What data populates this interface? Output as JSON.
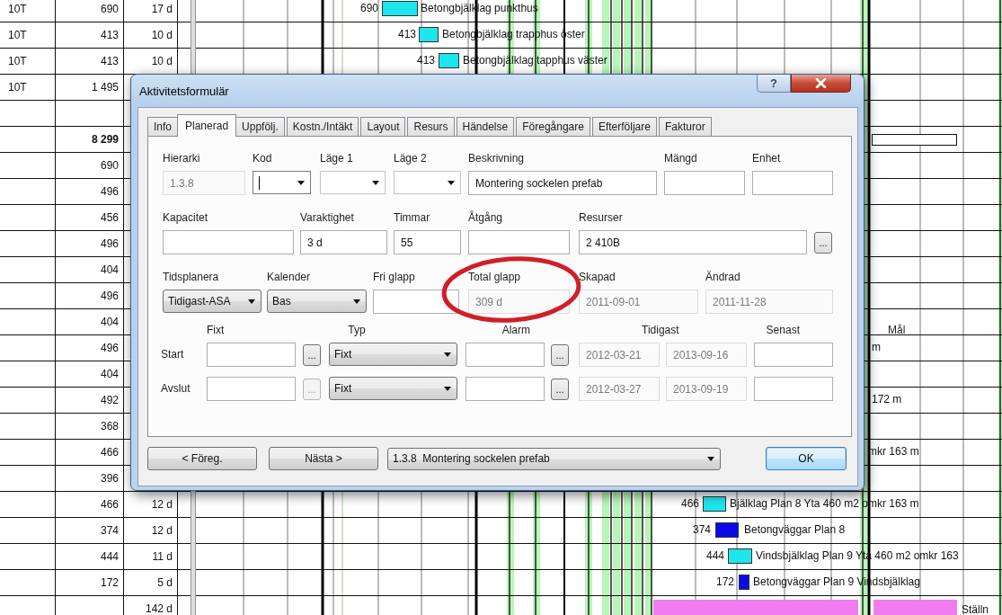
{
  "sheet": {
    "rows": [
      {
        "kind": "task",
        "code": "10T",
        "amount": "690",
        "duration": "17 d",
        "bar": {
          "kind": "task",
          "value": "690",
          "color": "#1ee6ee",
          "label": "Betongbjälklag punkthus"
        }
      },
      {
        "kind": "task",
        "code": "10T",
        "amount": "413",
        "duration": "10 d",
        "bar": {
          "kind": "task",
          "value": "413",
          "color": "#1ee6ee",
          "label": "Betongbjälklag trapphus öster"
        }
      },
      {
        "kind": "task",
        "code": "10T",
        "amount": "413",
        "duration": "10 d",
        "bar": {
          "kind": "task",
          "value": "413",
          "color": "#1ee6ee",
          "label": "Betongbjälklag tapphus väster"
        }
      },
      {
        "kind": "task",
        "code": "10T",
        "amount": "1 495"
      },
      {},
      {
        "kind": "total",
        "amount": "8 299",
        "bar": {
          "kind": "summary"
        }
      },
      {
        "kind": "task",
        "amount": "690"
      },
      {
        "kind": "task",
        "amount": "496"
      },
      {
        "kind": "task",
        "amount": "456"
      },
      {
        "kind": "task",
        "amount": "496"
      },
      {
        "kind": "task",
        "amount": "404"
      },
      {
        "kind": "task",
        "amount": "496"
      },
      {
        "kind": "task",
        "amount": "404"
      },
      {
        "kind": "task",
        "amount": "496",
        "bar": {
          "kind": "label",
          "label": "m"
        }
      },
      {
        "kind": "task",
        "amount": "404"
      },
      {
        "kind": "task",
        "amount": "492",
        "bar": {
          "kind": "label",
          "label": "172 m"
        }
      },
      {
        "kind": "task",
        "amount": "368"
      },
      {
        "kind": "task",
        "amount": "466",
        "bar": {
          "kind": "label",
          "label": "mkr 163 m"
        }
      },
      {
        "kind": "task",
        "amount": "396"
      },
      {
        "kind": "task",
        "amount": "466",
        "duration": "12 d",
        "bar": {
          "kind": "task",
          "value": "466",
          "color": "#1ee6ee",
          "label": "Bjälklag Plan 8 Yta 460 m2 omkr 163 m"
        }
      },
      {
        "kind": "task",
        "amount": "374",
        "duration": "12 d",
        "bar": {
          "kind": "task",
          "value": "374",
          "color": "#0a0ae6",
          "label": "Betongväggar Plan 8"
        }
      },
      {
        "kind": "task",
        "amount": "444",
        "duration": "11 d",
        "bar": {
          "kind": "task",
          "value": "444",
          "color": "#1ee6ee",
          "label": "Vindsbjälklag Plan 9 Yta 460 m2 omkr 163"
        }
      },
      {
        "kind": "task",
        "amount": "172",
        "duration": "5 d",
        "bar": {
          "kind": "task",
          "value": "172",
          "color": "#0a0ae6",
          "label": "Betongväggar Plan 9 Vindsbjälklag"
        }
      },
      {
        "duration": "142 d",
        "bar": {
          "kind": "phase",
          "color": "#f07cf0",
          "label": "Ställn"
        }
      }
    ]
  },
  "dialog": {
    "title": "Aktivitetsformulär",
    "help": "?",
    "tabs": [
      {
        "label": "Info",
        "selected": false
      },
      {
        "label": "Planerad",
        "selected": true
      },
      {
        "label": "Uppfölj.",
        "selected": false
      },
      {
        "label": "Kostn./Intäkt",
        "selected": false
      },
      {
        "label": "Layout",
        "selected": false
      },
      {
        "label": "Resurs",
        "selected": false
      },
      {
        "label": "Händelse",
        "selected": false
      },
      {
        "label": "Föregångare",
        "selected": false
      },
      {
        "label": "Efterföljare",
        "selected": false
      },
      {
        "label": "Fakturor",
        "selected": false
      }
    ],
    "form": {
      "rows": [
        {
          "fields": [
            {
              "label": "Hierarki",
              "kind": "text",
              "value": "1.3.8",
              "disabled": true,
              "focused": false
            },
            {
              "label": "Kod",
              "kind": "combo",
              "disabled": false,
              "focused": true
            },
            {
              "label": "Läge 1",
              "kind": "combo",
              "disabled": false,
              "focused": false
            },
            {
              "label": "Läge 2",
              "kind": "combo",
              "disabled": false,
              "focused": false
            },
            {
              "label": "Beskrivning",
              "kind": "text",
              "value": "Montering sockelen prefab",
              "disabled": false,
              "focused": false
            },
            {
              "label": "Mängd",
              "kind": "text",
              "disabled": false,
              "focused": false
            },
            {
              "label": "Enhet",
              "kind": "text",
              "disabled": false,
              "focused": false
            }
          ]
        },
        {
          "fields": [
            {
              "label": "Kapacitet",
              "kind": "text",
              "disabled": false,
              "focused": false
            },
            {
              "label": "Varaktighet",
              "kind": "text",
              "value": "3 d",
              "disabled": false,
              "focused": false
            },
            {
              "label": "Timmar",
              "kind": "text",
              "value": "55",
              "disabled": false,
              "focused": false
            },
            {
              "label": "Åtgång",
              "kind": "text",
              "disabled": false,
              "focused": false
            },
            {
              "label": "Resurser",
              "kind": "text",
              "value": "2 410B",
              "disabled": false,
              "focused": false
            },
            {
              "kind": "button",
              "value": "...",
              "disabled": false,
              "focused": false
            }
          ]
        },
        {
          "fields": [
            {
              "label": "Tidsplanera",
              "kind": "dropdown",
              "value": "Tidigast-ASA",
              "disabled": false,
              "focused": false
            },
            {
              "label": "Kalender",
              "kind": "dropdown",
              "value": "Bas",
              "disabled": false,
              "focused": false
            },
            {
              "label": "Fri glapp",
              "kind": "text",
              "disabled": false,
              "focused": false
            },
            {
              "label": "Total glapp",
              "kind": "text",
              "value": "309 d",
              "disabled": true,
              "focused": false
            },
            {
              "label": "Skapad",
              "kind": "text",
              "value": "2011-09-01",
              "disabled": true,
              "focused": false
            },
            {
              "label": "Ändrad",
              "kind": "text",
              "value": "2011-11-28",
              "disabled": true,
              "focused": false
            }
          ]
        }
      ]
    },
    "schedule": {
      "headers": [
        "Fixt",
        "Typ",
        "Alarm",
        "Tidigast",
        "Senast",
        "Mål"
      ],
      "rows": [
        {
          "label": "Start",
          "fields": [
            {
              "kind": "text",
              "disabled": false
            },
            {
              "kind": "button",
              "value": "...",
              "disabled": false
            },
            {
              "kind": "dropdown",
              "value": "Fixt",
              "disabled": false
            },
            {
              "kind": "text",
              "disabled": false
            },
            {
              "kind": "button",
              "value": "...",
              "disabled": false
            },
            {
              "kind": "text",
              "value": "2012-03-21",
              "disabled": true
            },
            {
              "kind": "text",
              "value": "2013-09-16",
              "disabled": true
            },
            {
              "kind": "text",
              "disabled": false
            }
          ]
        },
        {
          "label": "Avslut",
          "fields": [
            {
              "kind": "text",
              "disabled": false
            },
            {
              "kind": "button",
              "value": "...",
              "disabled": true
            },
            {
              "kind": "dropdown",
              "value": "Fixt",
              "disabled": false
            },
            {
              "kind": "text",
              "disabled": false
            },
            {
              "kind": "button",
              "value": "...",
              "disabled": false
            },
            {
              "kind": "text",
              "value": "2012-03-27",
              "disabled": true
            },
            {
              "kind": "text",
              "value": "2013-09-19",
              "disabled": true
            },
            {
              "kind": "text",
              "disabled": false
            }
          ]
        }
      ]
    },
    "footer": {
      "previous": "< Föreg.",
      "next": "Nästa >",
      "activity": "1.3.8  Montering sockelen prefab",
      "ok": "OK"
    }
  }
}
